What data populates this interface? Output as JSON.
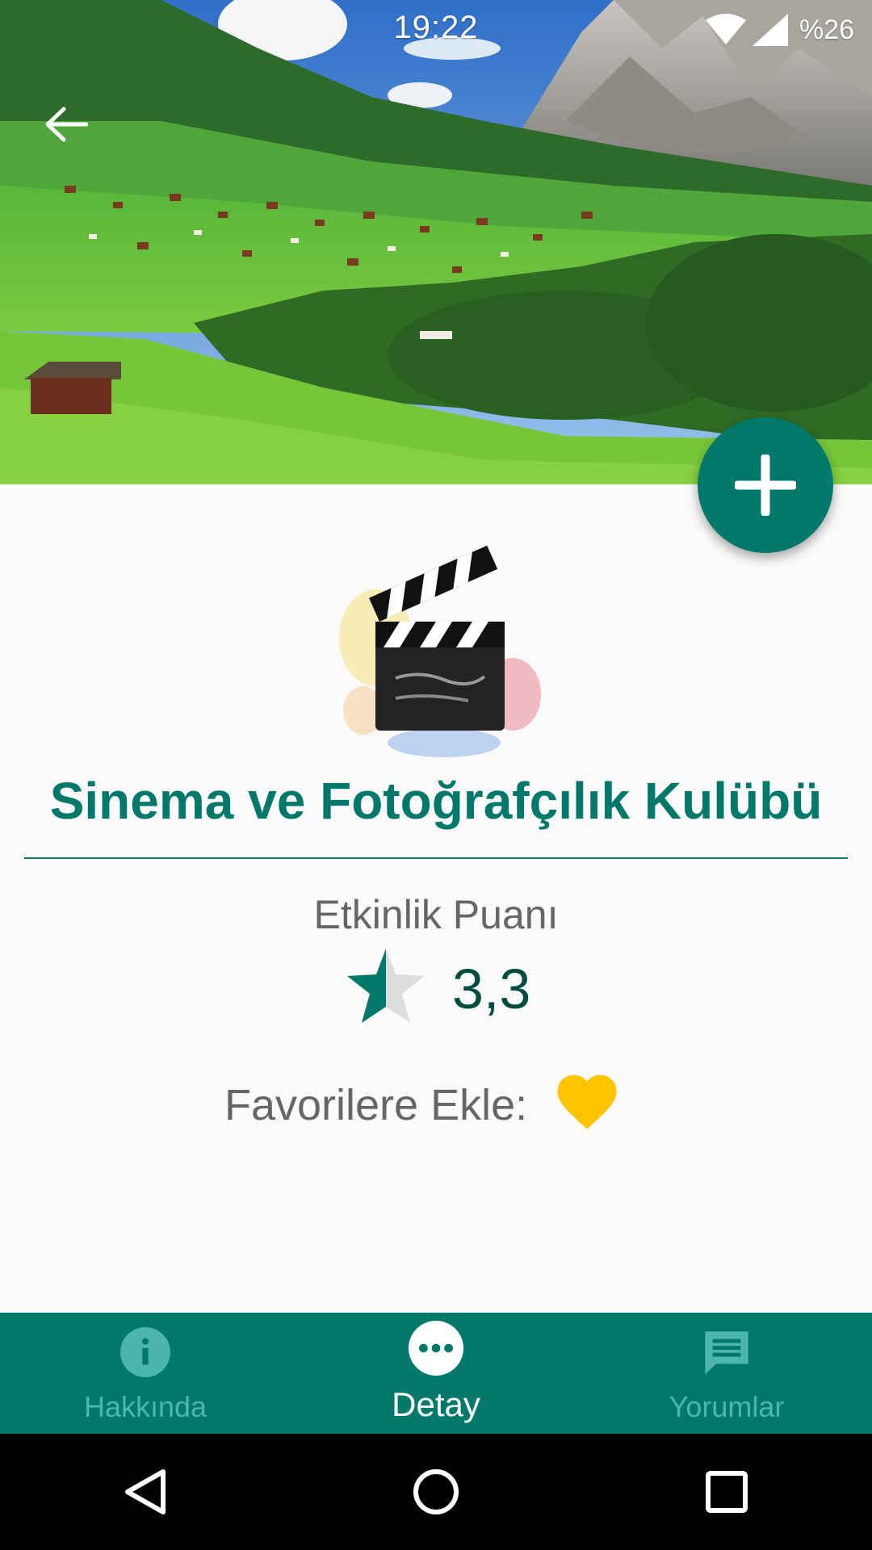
{
  "status_bar": {
    "time": "19:22",
    "battery": "%26",
    "icons": [
      "wifi-icon",
      "cell-signal-icon"
    ]
  },
  "header": {
    "back_icon": "arrow-back-icon",
    "fab_icon": "plus-icon"
  },
  "club": {
    "logo_icon": "clapperboard-icon",
    "title": "Sinema ve Fotoğrafçılık Kulübü"
  },
  "rating": {
    "label": "Etkinlik Puanı",
    "value": "3,3",
    "star_fill": 0.5,
    "star_icon": "half-star-icon"
  },
  "favorites": {
    "label": "Favorilere Ekle:",
    "icon": "heart-icon"
  },
  "bottom_nav": {
    "items": [
      {
        "label": "Hakkında",
        "icon": "info-icon",
        "active": false
      },
      {
        "label": "Detay",
        "icon": "more-horiz-icon",
        "active": true
      },
      {
        "label": "Yorumlar",
        "icon": "comment-icon",
        "active": false
      }
    ]
  },
  "system_nav": [
    "back-triangle-icon",
    "home-circle-icon",
    "recents-square-icon"
  ],
  "colors": {
    "primary": "#00796B",
    "primary_dark": "#004D40",
    "nav_inactive": "#4DB6AC",
    "heart": "#FFC400",
    "background": "#FAFAFA"
  }
}
